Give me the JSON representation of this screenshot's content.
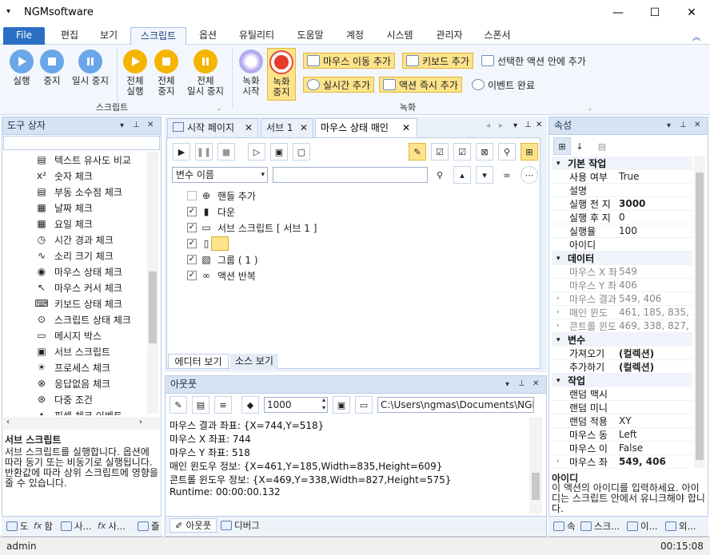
{
  "window": {
    "title": "NGMsoftware"
  },
  "ribbon_tabs": [
    "File",
    "편집",
    "보기",
    "스크립트",
    "옵션",
    "유틸리티",
    "도움말",
    "계정",
    "시스템",
    "관리자",
    "스폰서"
  ],
  "ribbon": {
    "script_group": {
      "label": "스크립트",
      "run": "실행",
      "stop": "중지",
      "pause": "일시 중지",
      "all_run": [
        "전체",
        "실행"
      ],
      "all_stop": [
        "전체",
        "중지"
      ],
      "all_pause": [
        "전체",
        "일시 중지"
      ]
    },
    "record_group": {
      "label": "녹화",
      "record_start": [
        "녹화",
        "시작"
      ],
      "record_stop": [
        "녹화",
        "중지"
      ],
      "mouse_move_add": "마우스 이동 추가",
      "keyboard_add": "키보드 추가",
      "add_in_action": "선택한 액션 안에 추가",
      "realtime_add": "실시간 추가",
      "action_instant_add": "액션 즉시 추가",
      "event_done": "이벤트 완료"
    }
  },
  "toolbox": {
    "title": "도구 상자",
    "items": [
      "텍스트 유사도 비교",
      "숫자 체크",
      "부동 소수점 체크",
      "날짜 체크",
      "요일 체크",
      "시간 경과 체크",
      "소리 크기 체크",
      "마우스 상태 체크",
      "마우스 커서 체크",
      "키보드 상태 체크",
      "스크립트 상태 체크",
      "메시지 박스",
      "서브 스크립트",
      "프로세스 체크",
      "응답없음 체크",
      "다중 조건",
      "픽셀 체크 이벤트"
    ],
    "desc_title": "서브 스크립트",
    "desc_text": "서브 스크립트를 실행합니다. 옵션에 따라 동기 또는 비동기로 실행됩니다. 반환값에 따라 상위 스크립트에 영향을 줄 수 있습니다.",
    "bottom_tabs": [
      "도",
      "함",
      "사...",
      "사...",
      "즐"
    ]
  },
  "docs": {
    "tabs": [
      "시작 페이지",
      "서브 1",
      "마우스 상태 매인"
    ],
    "variable_select": "변수 이름",
    "tree": [
      {
        "label": "핸들 추가",
        "checked": false
      },
      {
        "label": "다운",
        "checked": true
      },
      {
        "label": "서브 스크립트 [ 서브 1 ]",
        "checked": true
      },
      {
        "label": "",
        "checked": true
      },
      {
        "label": "그룹 ( 1 )",
        "checked": true
      },
      {
        "label": "액션 반복",
        "checked": true
      }
    ],
    "view_tabs": [
      "에디터 보기",
      "소스 보기"
    ]
  },
  "output": {
    "title": "아웃풋",
    "count": "1000",
    "path": "C:\\Users\\ngmas\\Documents\\NGM6\\",
    "lines": [
      "마우스 결과 좌표: {X=744,Y=518}",
      "마우스 X 좌표: 744",
      "마우스 Y 좌표: 518",
      "매인 윈도우 정보: {X=461,Y=185,Width=835,Height=609}",
      "콘트롤 윈도우 정보: {X=469,Y=338,Width=827,Height=575}",
      "Runtime: 00:00:00.132"
    ],
    "bottom_tabs": [
      "아웃풋",
      "디버그"
    ]
  },
  "properties": {
    "title": "속성",
    "cat_basic": "기본 작업",
    "basic": [
      [
        "사용 여부",
        "True"
      ],
      [
        "설명",
        ""
      ],
      [
        "실행 전 지",
        "3000"
      ],
      [
        "실행 후 지",
        "0"
      ],
      [
        "실행율",
        "100"
      ],
      [
        "아이디",
        ""
      ]
    ],
    "cat_data": "데이터",
    "data": [
      [
        "마우스 X 좌",
        "549"
      ],
      [
        "마우스 Y 좌",
        "406"
      ],
      [
        "마우스 결과",
        "549, 406"
      ],
      [
        "매인 윈도",
        "461, 185, 835, 609"
      ],
      [
        "콘트롤 윈도",
        "469, 338, 827, 575"
      ]
    ],
    "cat_var": "변수",
    "vars": [
      [
        "가져오기",
        "(컬렉션)"
      ],
      [
        "추가하기",
        "(컬렉션)"
      ]
    ],
    "cat_action": "작업",
    "action": [
      [
        "랜덤 맥시",
        ""
      ],
      [
        "랜덤 미니",
        ""
      ],
      [
        "랜덤 적용",
        "XY"
      ],
      [
        "마우스 동",
        "Left"
      ],
      [
        "마우스 이",
        "False"
      ],
      [
        "마우스 좌",
        "549, 406"
      ]
    ],
    "desc_title": "아이디",
    "desc_text": "이 액션의 아이디를 입력하세요. 아이디는 스크립트 안에서 유니크해야 합니다.",
    "bottom_tabs": [
      "속",
      "스크...",
      "이...",
      "외..."
    ]
  },
  "status": {
    "user": "admin",
    "time": "00:15:08"
  }
}
